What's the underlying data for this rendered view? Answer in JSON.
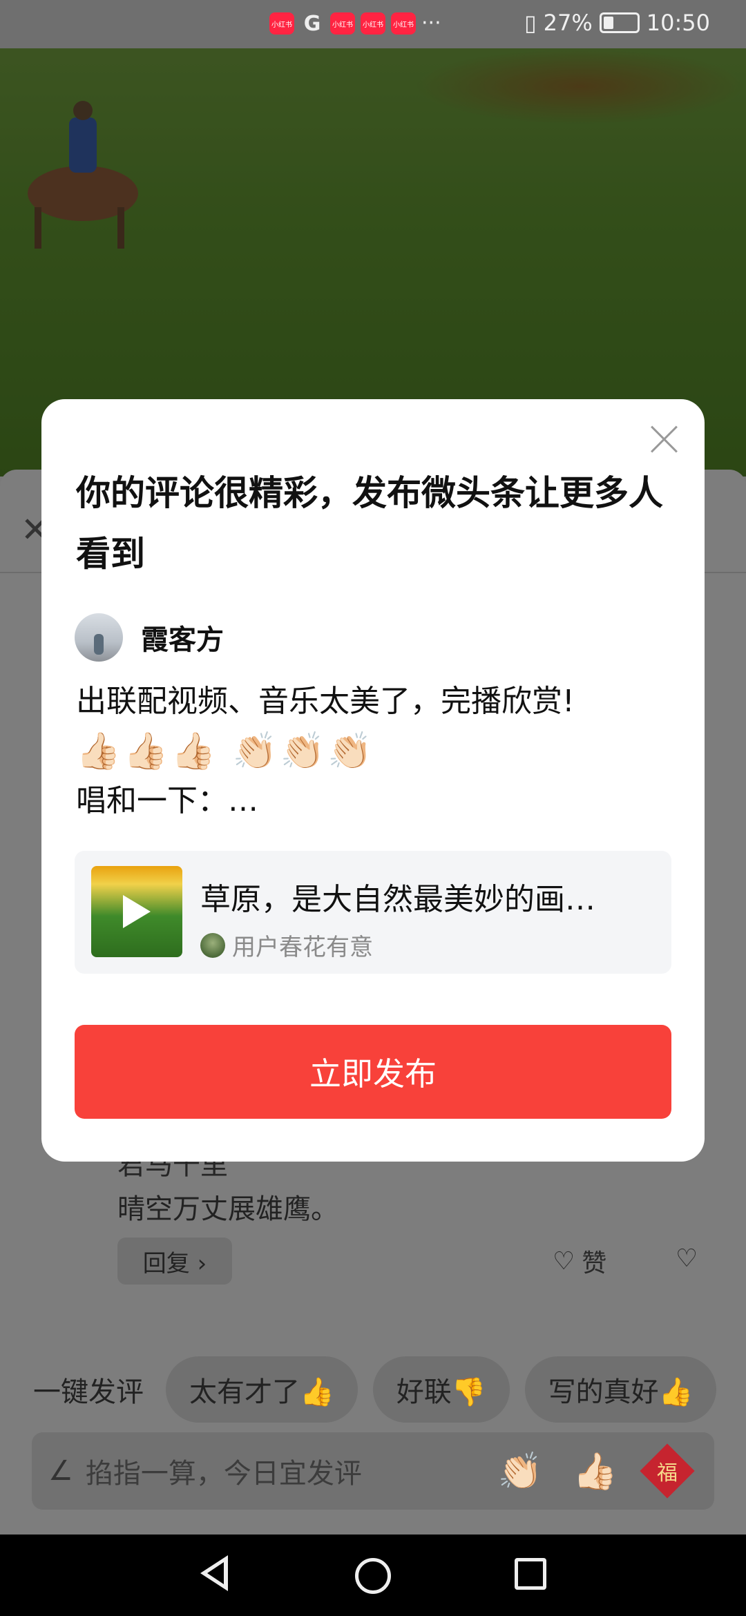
{
  "status_bar": {
    "apps": [
      "小红书",
      "G",
      "小红书",
      "小红书",
      "小红书"
    ],
    "more": "···",
    "battery": "27%",
    "time": "10:50"
  },
  "modal": {
    "title": "你的评论很精彩，发布微头条让更多人看到",
    "author_name": "霞客方",
    "comment_line1": "出联配视频、音乐太美了，完播欣赏!",
    "comment_emojis": "👍🏻👍🏻👍🏻 👏🏻👏🏻👏🏻",
    "comment_line3": "唱和一下：…",
    "card_title": "草原，是大自然最美妙的画…",
    "card_user": "用户春花有意",
    "publish_label": "立即发布"
  },
  "background_page": {
    "comment_partial_line": "君马千里",
    "comment_line": "晴空万丈展雄鹰。",
    "reply_label": "回复 ›",
    "like_label": "赞"
  },
  "quick_comments": {
    "title": "一键发评",
    "chips": [
      "太有才了👍",
      "好联👎",
      "写的真好👍"
    ]
  },
  "input_bar": {
    "placeholder": "掐指一算，今日宜发评",
    "emoji_clap": "👏🏻",
    "emoji_thumb": "👍🏻",
    "fu": "福"
  }
}
